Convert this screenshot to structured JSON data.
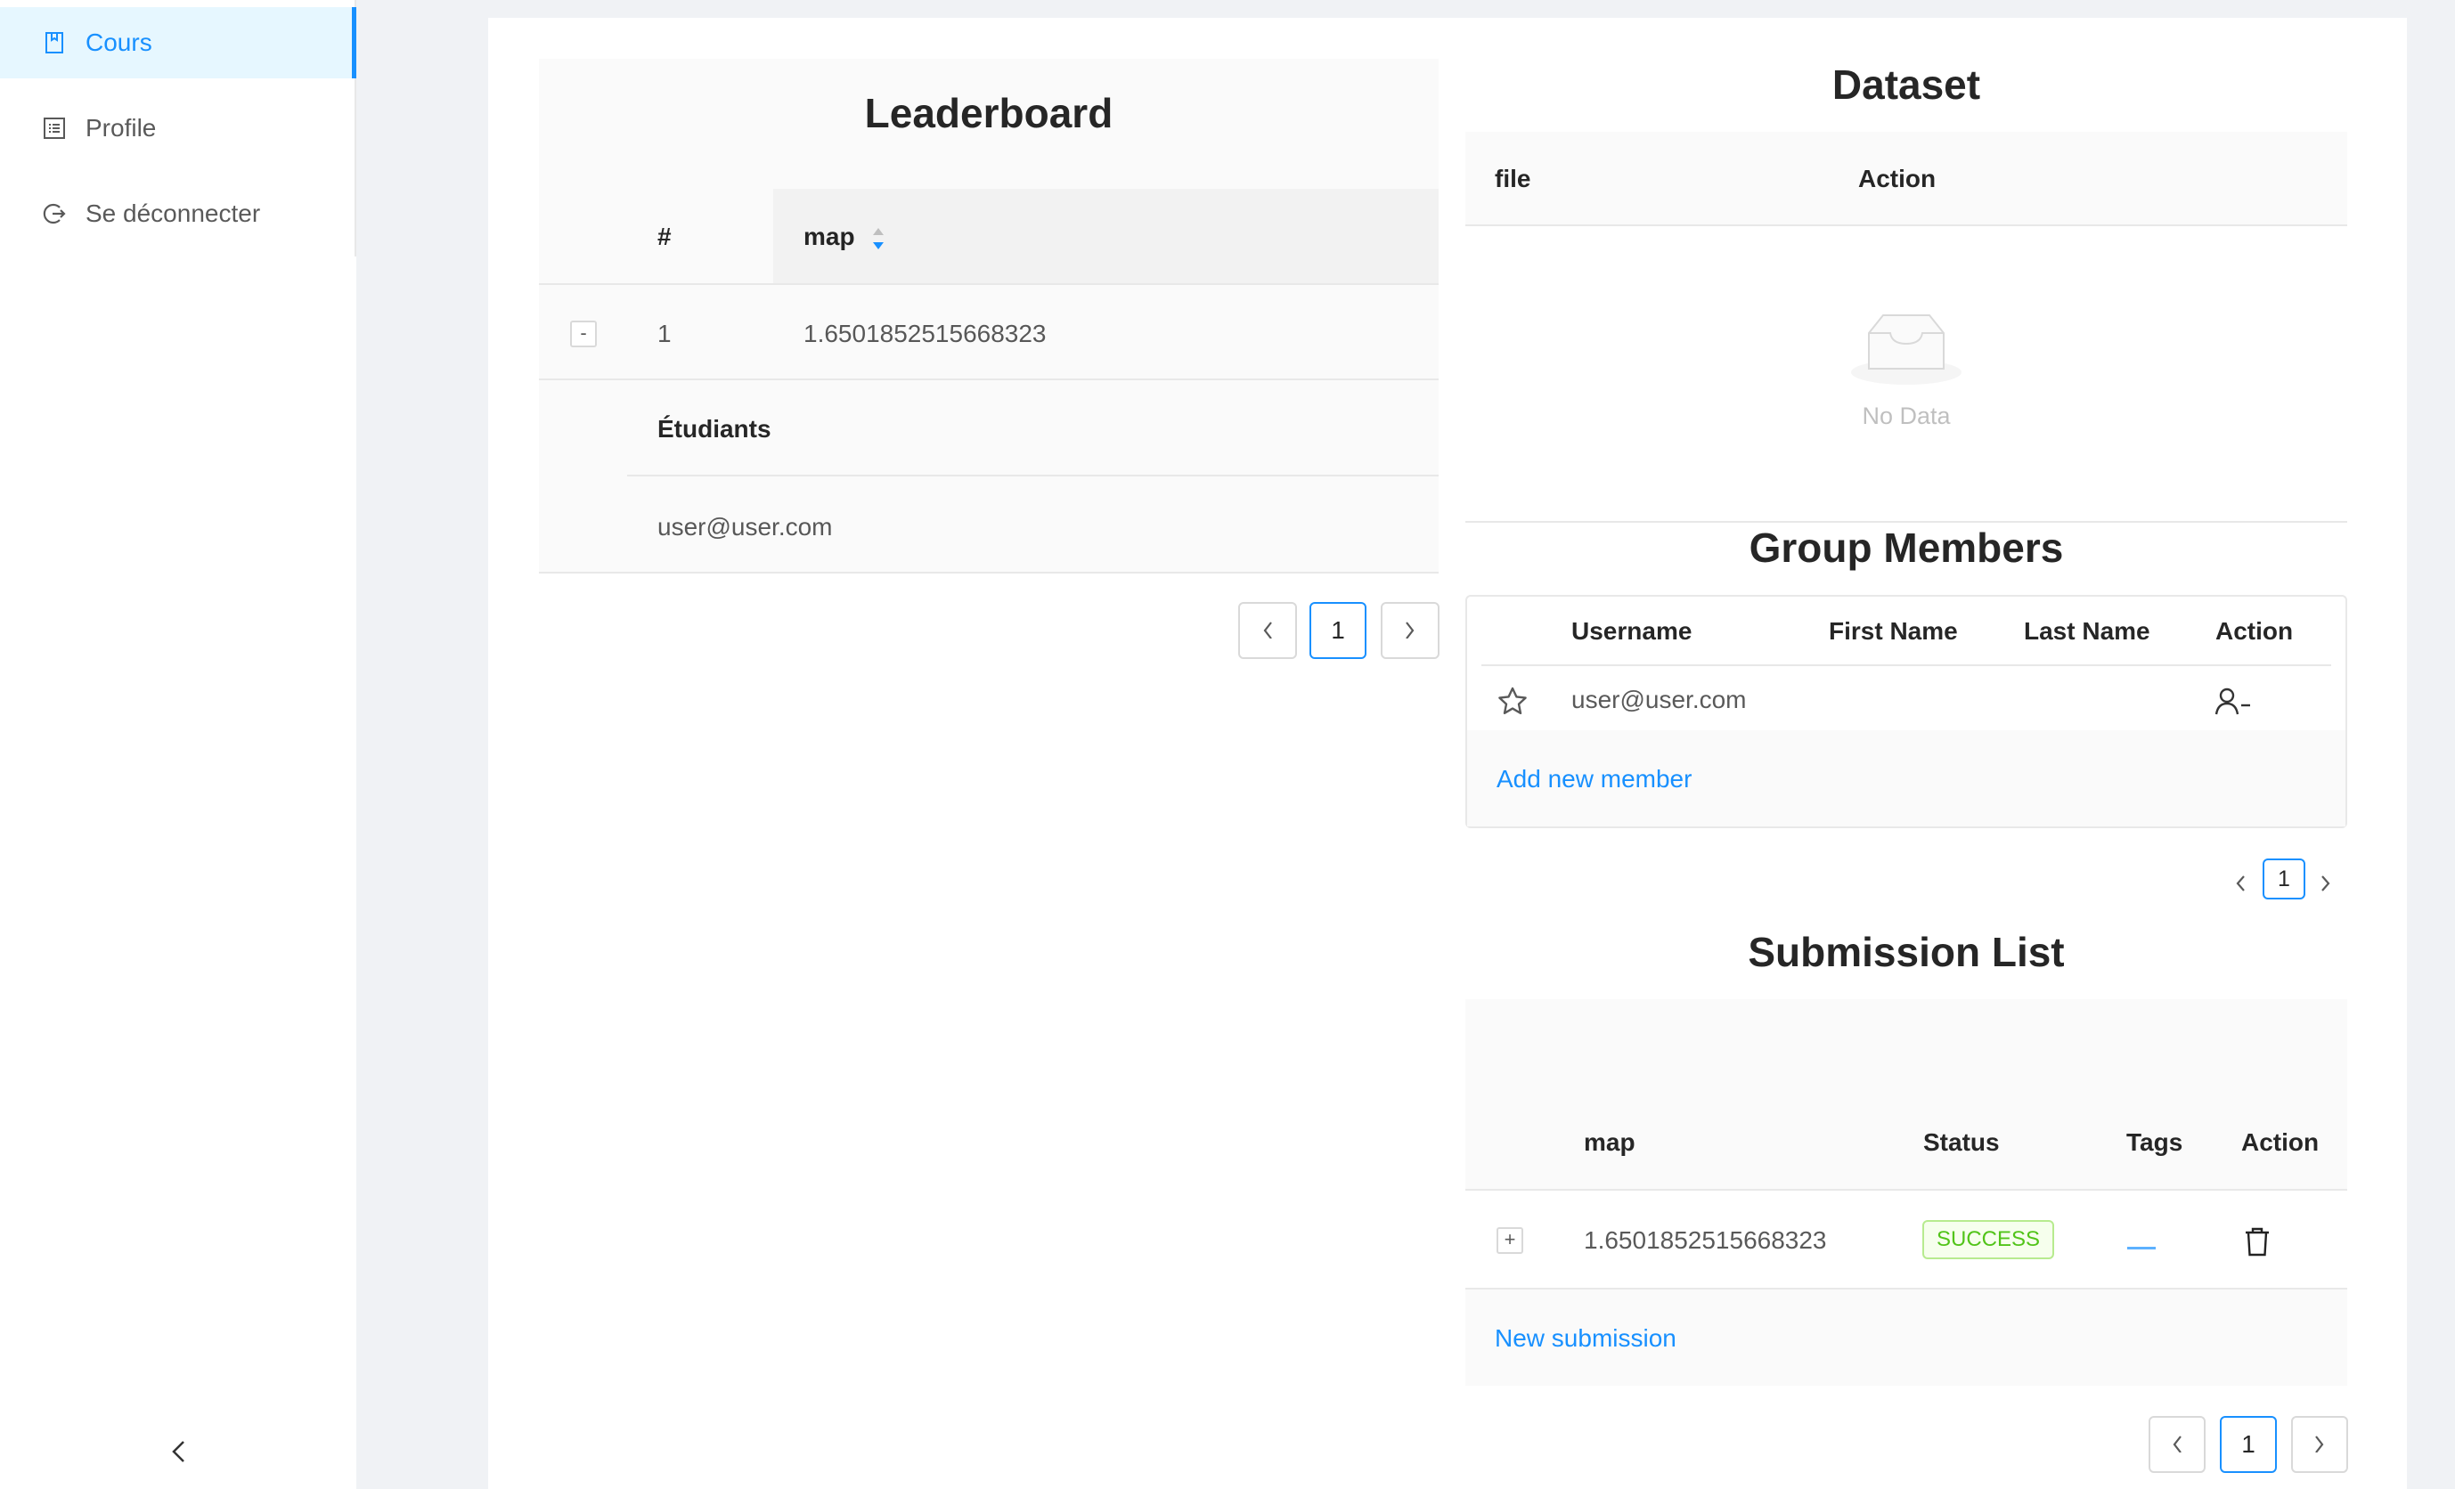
{
  "sidebar": {
    "items": [
      {
        "label": "Cours",
        "icon": "book-icon",
        "active": true
      },
      {
        "label": "Profile",
        "icon": "profile-icon",
        "active": false
      },
      {
        "label": "Se déconnecter",
        "icon": "logout-icon",
        "active": false
      }
    ],
    "collapse_icon": "chevron-left-icon"
  },
  "leaderboard": {
    "title": "Leaderboard",
    "columns": [
      "#",
      "map"
    ],
    "rows": [
      {
        "rank": "1",
        "map": "1.6501852515668323",
        "expand_symbol": "-"
      }
    ],
    "nested": {
      "column": "Étudiants",
      "rows": [
        "user@user.com"
      ]
    },
    "pagination": {
      "prev": "<",
      "current": "1",
      "next": ">"
    }
  },
  "dataset": {
    "title": "Dataset",
    "columns": [
      "file",
      "Action"
    ],
    "empty_text": "No Data"
  },
  "group_members": {
    "title": "Group Members",
    "columns": [
      "Username",
      "First Name",
      "Last Name",
      "Action"
    ],
    "rows": [
      {
        "username": "user@user.com",
        "first_name": "",
        "last_name": ""
      }
    ],
    "add_label": "Add new member",
    "pagination": {
      "prev": "<",
      "current": "1",
      "next": ">"
    }
  },
  "submission_list": {
    "title": "Submission List",
    "columns": [
      "map",
      "Status",
      "Tags",
      "Action"
    ],
    "rows": [
      {
        "map": "1.6501852515668323",
        "status": "SUCCESS",
        "expand_symbol": "+"
      }
    ],
    "new_label": "New submission",
    "pagination": {
      "prev": "<",
      "current": "1",
      "next": ">"
    }
  },
  "colors": {
    "accent": "#1890ff",
    "success": "#52c41a",
    "background": "#f0f2f5"
  }
}
